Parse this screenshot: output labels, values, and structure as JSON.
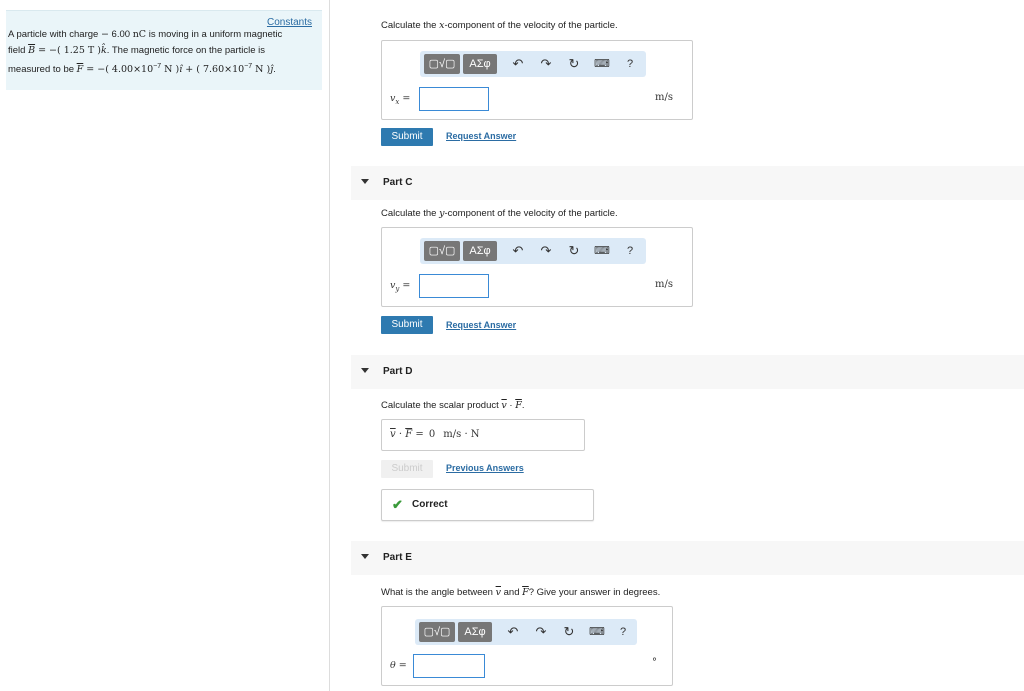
{
  "constants_link": "Constants",
  "problem": {
    "line1a": "A particle with charge ",
    "line1b": "−",
    "line1c": " 6.00 ",
    "line1d": "nC",
    "line1e": " is moving in a uniform magnetic",
    "line2a": "field ",
    "line2b": "B",
    "line2c": " = −( 1.25 ",
    "line2d": "T",
    "line2e": " )",
    "line2f": "k̂",
    "line2g": ". The magnetic force on the particle is",
    "line3a": "measured to be ",
    "line3b": "F",
    "line3c": " = −( 4.00×10",
    "line3d": "−7",
    "line3e": " N )",
    "line3f": "î",
    "line3g": " + ( 7.60×10",
    "line3h": "−7",
    "line3i": " N )",
    "line3j": "ĵ",
    "line3k": "."
  },
  "toolbar": {
    "template_label": "▢√▢",
    "greek_label": "ΑΣφ",
    "undo": "↶",
    "redo": "↷",
    "reset": "↻",
    "keyboard": "⌨",
    "help": "?"
  },
  "part_b": {
    "question_pre": "Calculate the ",
    "question_var": "x",
    "question_post": "-component of the velocity of the particle.",
    "var": "v",
    "var_sub": "x",
    "eq": " =",
    "unit": "m/s",
    "submit": "Submit",
    "request": "Request Answer"
  },
  "part_c": {
    "label": "Part C",
    "question_pre": "Calculate the ",
    "question_var": "y",
    "question_post": "-component of the velocity of the particle.",
    "var": "v",
    "var_sub": "y",
    "eq": " =",
    "unit": "m/s",
    "submit": "Submit",
    "request": "Request Answer"
  },
  "part_d": {
    "label": "Part D",
    "question_pre": "Calculate the scalar product ",
    "question_v": "v",
    "question_dot": " · ",
    "question_f": "F",
    "question_end": ".",
    "answer_v": "v",
    "answer_dot": " · ",
    "answer_f": "F",
    "answer_eq": " = ",
    "answer_value": "0",
    "answer_unit": "m/s · N",
    "submit": "Submit",
    "previous": "Previous Answers",
    "correct": "Correct"
  },
  "part_e": {
    "label": "Part E",
    "question_pre": "What is the angle between ",
    "question_v": "v",
    "question_mid": " and ",
    "question_f": "F",
    "question_post": "? Give your answer in degrees.",
    "var": "θ",
    "eq": " =",
    "unit": "°"
  },
  "colors": {
    "accent": "#2e7ab0",
    "link": "#2b6ca3",
    "correct": "#3a9a3a",
    "toolbar_bg": "#dceaf7",
    "constants_bg": "#eaf5f9"
  }
}
